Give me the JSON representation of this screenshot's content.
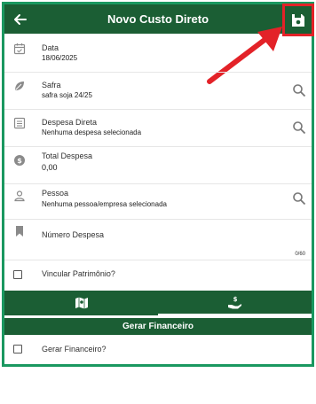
{
  "appbar": {
    "title": "Novo Custo Direto"
  },
  "fields": {
    "data": {
      "label": "Data",
      "value": "18/06/2025"
    },
    "safra": {
      "label": "Safra",
      "value": "safra soja 24/25"
    },
    "despesa_direta": {
      "label": "Despesa Direta",
      "value": "Nenhuma despesa selecionada"
    },
    "total_despesa": {
      "label": "Total Despesa",
      "value": "0,00"
    },
    "pessoa": {
      "label": "Pessoa",
      "value": "Nenhuma pessoa/empresa selecionada"
    },
    "numero_despesa": {
      "label": "Número Despesa",
      "counter": "0/60"
    },
    "vincular_patrimonio": {
      "label": "Vincular Patrimônio?",
      "checked": false
    }
  },
  "tabs": [
    {
      "icon": "map-icon",
      "selected": false
    },
    {
      "icon": "hand-money-icon",
      "selected": true
    }
  ],
  "financeiro": {
    "section_title": "Gerar Financeiro",
    "checkbox_label": "Gerar Financeiro?",
    "checked": false
  },
  "colors": {
    "primary": "#1b5e34",
    "frame_border": "#1a9860",
    "highlight": "#e32228",
    "icon_gray": "#8a8a8a"
  }
}
